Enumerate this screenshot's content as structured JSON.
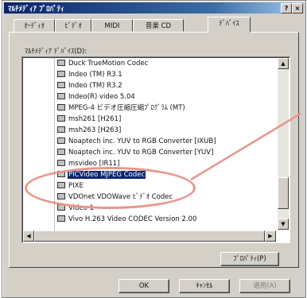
{
  "window": {
    "title": "ﾏﾙﾁﾒﾃﾞｨｱ ﾌﾟﾛﾊﾟﾃｨ",
    "help_btn": "?",
    "close_btn": "×"
  },
  "tabs": [
    {
      "label": "ｵｰﾃﾞｨｵ"
    },
    {
      "label": "ﾋﾞﾃﾞｵ"
    },
    {
      "label": "MIDI"
    },
    {
      "label": "音楽 CD"
    },
    {
      "label": "ﾃﾞﾊﾞｲｽ"
    }
  ],
  "active_tab": "ﾃﾞﾊﾞｲｽ",
  "devices_label": "ﾏﾙﾁﾒﾃﾞｨｱ ﾃﾞﾊﾞｲｽ(D):",
  "devices": [
    {
      "label": "Duck TrueMotion Codec",
      "selected": false
    },
    {
      "label": "Indeo (TM) R3.1",
      "selected": false
    },
    {
      "label": "Indeo (TM) R3.2",
      "selected": false
    },
    {
      "label": "Indeo(R) video 5.04",
      "selected": false
    },
    {
      "label": "MPEG-4 ビデオ圧縮圧縮ﾌﾟﾛｸﾞﾗﾑ (MT)",
      "selected": false
    },
    {
      "label": "msh261 [H261]",
      "selected": false
    },
    {
      "label": "msh263 [H263]",
      "selected": false
    },
    {
      "label": "Noaptech inc. YUV to RGB Converter [IXUB]",
      "selected": false
    },
    {
      "label": "Noaptech inc. YUV to RGB Converter [YUV]",
      "selected": false
    },
    {
      "label": "msvideo [IR11]",
      "selected": false
    },
    {
      "label": "PICVideo MJPEG Codec",
      "selected": true
    },
    {
      "label": "PIXE",
      "selected": false
    },
    {
      "label": "VDOnet VDOWave ﾋﾞﾃﾞｵ Codec",
      "selected": false
    },
    {
      "label": "Video 1",
      "selected": false
    },
    {
      "label": "Vivo H.263 Video CODEC Version 2.00",
      "selected": false
    }
  ],
  "buttons": {
    "properties": "ﾌﾟﾛﾊﾟﾃｨ(P)",
    "ok": "OK",
    "cancel": "ｷｬﾝｾﾙ",
    "apply": "適用(A)"
  },
  "scroll": {
    "up": "▲",
    "down": "▼",
    "left": "◀",
    "right": "▶"
  },
  "colors": {
    "highlight": "#0a246a",
    "callout": "#e8968c",
    "face": "#d4d0c8"
  }
}
